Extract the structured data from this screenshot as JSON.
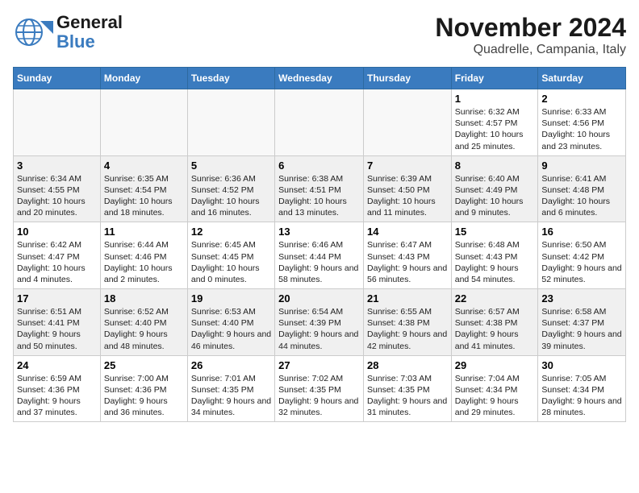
{
  "header": {
    "logo_line1": "General",
    "logo_line2": "Blue",
    "title": "November 2024",
    "subtitle": "Quadrelle, Campania, Italy"
  },
  "weekdays": [
    "Sunday",
    "Monday",
    "Tuesday",
    "Wednesday",
    "Thursday",
    "Friday",
    "Saturday"
  ],
  "weeks": [
    [
      {
        "day": "",
        "info": ""
      },
      {
        "day": "",
        "info": ""
      },
      {
        "day": "",
        "info": ""
      },
      {
        "day": "",
        "info": ""
      },
      {
        "day": "",
        "info": ""
      },
      {
        "day": "1",
        "info": "Sunrise: 6:32 AM\nSunset: 4:57 PM\nDaylight: 10 hours and 25 minutes."
      },
      {
        "day": "2",
        "info": "Sunrise: 6:33 AM\nSunset: 4:56 PM\nDaylight: 10 hours and 23 minutes."
      }
    ],
    [
      {
        "day": "3",
        "info": "Sunrise: 6:34 AM\nSunset: 4:55 PM\nDaylight: 10 hours and 20 minutes."
      },
      {
        "day": "4",
        "info": "Sunrise: 6:35 AM\nSunset: 4:54 PM\nDaylight: 10 hours and 18 minutes."
      },
      {
        "day": "5",
        "info": "Sunrise: 6:36 AM\nSunset: 4:52 PM\nDaylight: 10 hours and 16 minutes."
      },
      {
        "day": "6",
        "info": "Sunrise: 6:38 AM\nSunset: 4:51 PM\nDaylight: 10 hours and 13 minutes."
      },
      {
        "day": "7",
        "info": "Sunrise: 6:39 AM\nSunset: 4:50 PM\nDaylight: 10 hours and 11 minutes."
      },
      {
        "day": "8",
        "info": "Sunrise: 6:40 AM\nSunset: 4:49 PM\nDaylight: 10 hours and 9 minutes."
      },
      {
        "day": "9",
        "info": "Sunrise: 6:41 AM\nSunset: 4:48 PM\nDaylight: 10 hours and 6 minutes."
      }
    ],
    [
      {
        "day": "10",
        "info": "Sunrise: 6:42 AM\nSunset: 4:47 PM\nDaylight: 10 hours and 4 minutes."
      },
      {
        "day": "11",
        "info": "Sunrise: 6:44 AM\nSunset: 4:46 PM\nDaylight: 10 hours and 2 minutes."
      },
      {
        "day": "12",
        "info": "Sunrise: 6:45 AM\nSunset: 4:45 PM\nDaylight: 10 hours and 0 minutes."
      },
      {
        "day": "13",
        "info": "Sunrise: 6:46 AM\nSunset: 4:44 PM\nDaylight: 9 hours and 58 minutes."
      },
      {
        "day": "14",
        "info": "Sunrise: 6:47 AM\nSunset: 4:43 PM\nDaylight: 9 hours and 56 minutes."
      },
      {
        "day": "15",
        "info": "Sunrise: 6:48 AM\nSunset: 4:43 PM\nDaylight: 9 hours and 54 minutes."
      },
      {
        "day": "16",
        "info": "Sunrise: 6:50 AM\nSunset: 4:42 PM\nDaylight: 9 hours and 52 minutes."
      }
    ],
    [
      {
        "day": "17",
        "info": "Sunrise: 6:51 AM\nSunset: 4:41 PM\nDaylight: 9 hours and 50 minutes."
      },
      {
        "day": "18",
        "info": "Sunrise: 6:52 AM\nSunset: 4:40 PM\nDaylight: 9 hours and 48 minutes."
      },
      {
        "day": "19",
        "info": "Sunrise: 6:53 AM\nSunset: 4:40 PM\nDaylight: 9 hours and 46 minutes."
      },
      {
        "day": "20",
        "info": "Sunrise: 6:54 AM\nSunset: 4:39 PM\nDaylight: 9 hours and 44 minutes."
      },
      {
        "day": "21",
        "info": "Sunrise: 6:55 AM\nSunset: 4:38 PM\nDaylight: 9 hours and 42 minutes."
      },
      {
        "day": "22",
        "info": "Sunrise: 6:57 AM\nSunset: 4:38 PM\nDaylight: 9 hours and 41 minutes."
      },
      {
        "day": "23",
        "info": "Sunrise: 6:58 AM\nSunset: 4:37 PM\nDaylight: 9 hours and 39 minutes."
      }
    ],
    [
      {
        "day": "24",
        "info": "Sunrise: 6:59 AM\nSunset: 4:36 PM\nDaylight: 9 hours and 37 minutes."
      },
      {
        "day": "25",
        "info": "Sunrise: 7:00 AM\nSunset: 4:36 PM\nDaylight: 9 hours and 36 minutes."
      },
      {
        "day": "26",
        "info": "Sunrise: 7:01 AM\nSunset: 4:35 PM\nDaylight: 9 hours and 34 minutes."
      },
      {
        "day": "27",
        "info": "Sunrise: 7:02 AM\nSunset: 4:35 PM\nDaylight: 9 hours and 32 minutes."
      },
      {
        "day": "28",
        "info": "Sunrise: 7:03 AM\nSunset: 4:35 PM\nDaylight: 9 hours and 31 minutes."
      },
      {
        "day": "29",
        "info": "Sunrise: 7:04 AM\nSunset: 4:34 PM\nDaylight: 9 hours and 29 minutes."
      },
      {
        "day": "30",
        "info": "Sunrise: 7:05 AM\nSunset: 4:34 PM\nDaylight: 9 hours and 28 minutes."
      }
    ]
  ]
}
